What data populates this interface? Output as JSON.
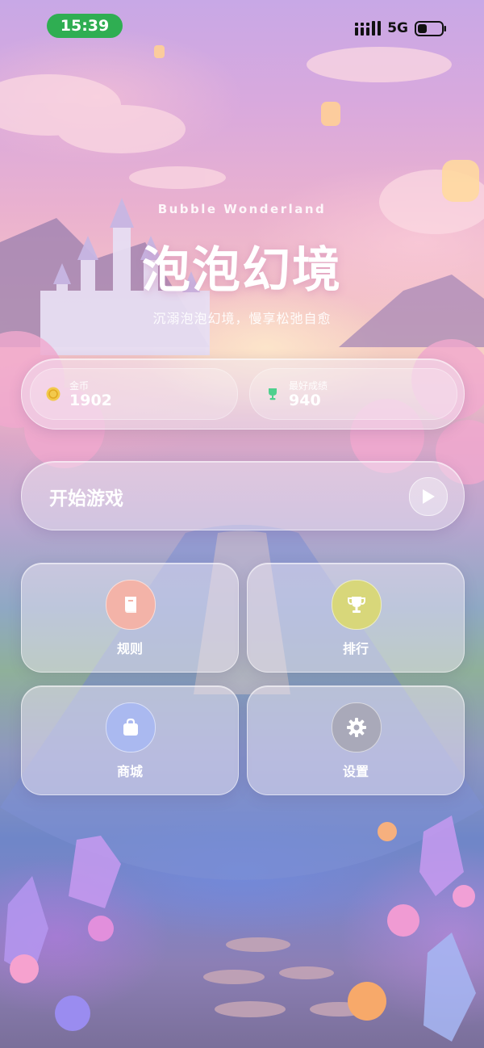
{
  "status_bar": {
    "time": "15:39",
    "network": "5G",
    "signal_icon": "signal-bars-icon",
    "battery_icon": "battery-icon"
  },
  "header": {
    "subtitle_en": "Bubble Wonderland",
    "title": "泡泡幻境",
    "tagline": "沉溺泡泡幻境，慢享松弛自愈"
  },
  "stats": {
    "coins": {
      "label": "金币",
      "value": "1902",
      "icon": "coin-icon",
      "color": "#f2c94c"
    },
    "best": {
      "label": "最好成绩",
      "value": "940",
      "icon": "trophy-icon",
      "color": "#4fd08e"
    }
  },
  "start": {
    "label": "开始游戏",
    "icon": "play-icon"
  },
  "menu": [
    {
      "id": "rules",
      "label": "规则",
      "icon": "book-icon",
      "color": "#f3b3a8"
    },
    {
      "id": "rank",
      "label": "排行",
      "icon": "trophy-icon",
      "color": "#d8d77a"
    },
    {
      "id": "shop",
      "label": "商城",
      "icon": "shopping-bag-icon",
      "color": "#aab9f0"
    },
    {
      "id": "settings",
      "label": "设置",
      "icon": "gear-icon",
      "color": "#a9a9b9"
    }
  ]
}
